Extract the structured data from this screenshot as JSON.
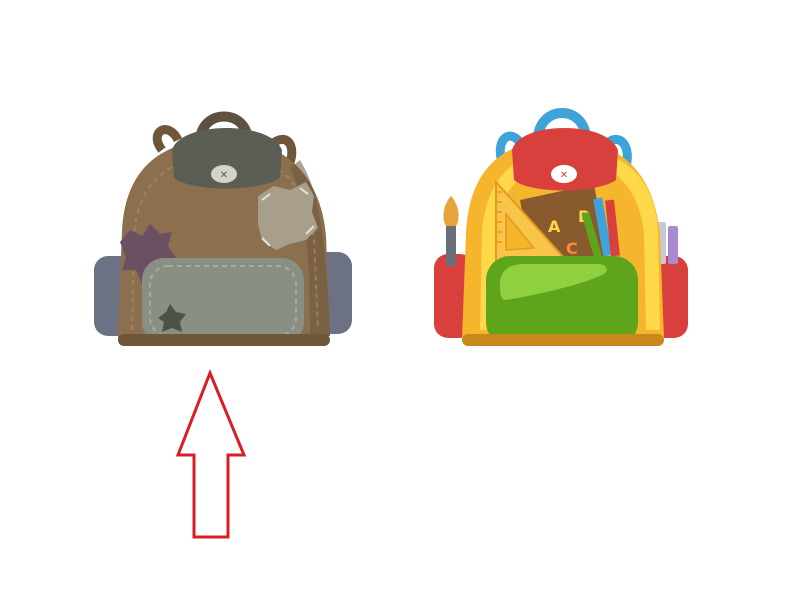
{
  "scene": {
    "background": "#ffffff"
  },
  "old_backpack": {
    "icon": "worn-patched-backpack",
    "colors": {
      "body": "#8b6f4e",
      "body_dark": "#6e563a",
      "flap": "#5b5e54",
      "handle": "#5e5144",
      "pocket": "#8a8f84",
      "side_pocket": "#6c7284",
      "patch_purple": "#6b4f63",
      "patch_gray": "#a89e8c"
    }
  },
  "new_backpack": {
    "icon": "school-supplies-backpack",
    "colors": {
      "body": "#f5b52c",
      "body_stripe": "#ffd84a",
      "flap": "#d8403e",
      "handle": "#3fa2d8",
      "pocket": "#5fa51b",
      "pocket_highlight": "#8fd041",
      "side_pocket": "#d8403e",
      "book": "#8a5a2f",
      "ruler": "#f8c44a"
    },
    "book_letters": [
      "A",
      "B",
      "C"
    ]
  },
  "pointer_arrow": {
    "icon": "up-arrow-outline-icon",
    "direction": "up",
    "target": "old_backpack",
    "color": "#d81e25"
  }
}
